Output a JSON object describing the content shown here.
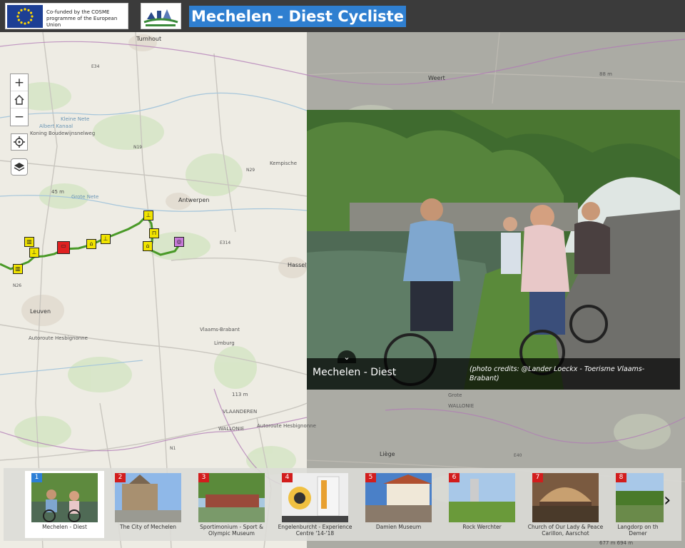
{
  "header": {
    "eu_text": "Co-funded by the COSME programme of the European Union",
    "title": "Mechelen - Diest Cycliste",
    "accent": "#2f7fd0"
  },
  "map": {
    "labels": {
      "turnhout": "Turnhout",
      "kleine_nete": "Kleine Nete",
      "albert_kanaal": "Albert Kanaal",
      "koning": "Koning Boudewijnsnelweg",
      "grote_nete": "Grote Nete",
      "antwerpen": "Antwerpen",
      "kempische": "Kempische",
      "leuven": "Leuven",
      "hesbignonne": "Autoroute Hesbignonne",
      "vlaams_brabant": "Vlaams-Brabant",
      "limburg": "Limburg",
      "vlaanderen": "VLAANDEREN",
      "wallonie": "WALLONIE",
      "hasselt": "Hasselt",
      "liege": "Liège",
      "weert": "Weert",
      "elev_45": "45 m",
      "elev_113": "113 m",
      "elev_88": "88 m",
      "e34": "E34",
      "e314": "E314",
      "e40": "E40",
      "n26": "N26",
      "n19": "N19",
      "n29": "N29",
      "n1": "N1",
      "wallonie_right": "WALLONIE",
      "grote_right": "Grote"
    },
    "controls": {
      "zoom_in": "+",
      "home_icon": "home",
      "zoom_out": "−",
      "locate_icon": "crosshair",
      "layers_icon": "layers"
    }
  },
  "popup": {
    "title": "Mechelen - Diest",
    "credit": "(photo credits: @Lander Loeckx - Toerisme Vlaams-Brabant)",
    "chevron": "⌄"
  },
  "carousel": {
    "items": [
      {
        "num": "1",
        "caption": "Mechelen - Diest",
        "active": true
      },
      {
        "num": "2",
        "caption": "The City of Mechelen"
      },
      {
        "num": "3",
        "caption": "Sportimonium - Sport & Olympic Museum"
      },
      {
        "num": "4",
        "caption": "Engelenburcht - Experience Centre '14-'18"
      },
      {
        "num": "5",
        "caption": "Damien Museum"
      },
      {
        "num": "6",
        "caption": "Rock Werchter"
      },
      {
        "num": "7",
        "caption": "Church of Our Lady & Peace Carillon, Aarschot"
      },
      {
        "num": "8",
        "caption": "Langdorp on th Demer"
      }
    ],
    "next_icon": "›"
  },
  "scale": "677 m    694 m"
}
